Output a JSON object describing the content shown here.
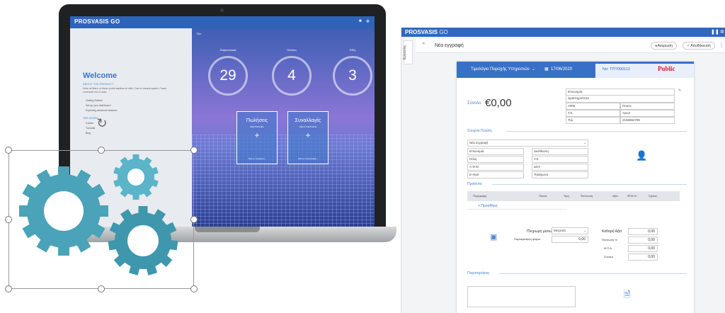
{
  "laptop_screen": {
    "logo": "PROSVASIS GO",
    "welcome": "Welcome",
    "about_title": "ABOUT THE PRODUCT",
    "about_text": "Dolor at libero ut donec porta dapibus mi nibh. Cras et mauris sapien. Fusce commodo est ut dolor.",
    "bullets": [
      "Getting Started",
      "Set up your dashboard",
      "Exploring advanced features"
    ],
    "see_more": "SEE MORE",
    "see_more_items": [
      "Guides",
      "Tutorials",
      "Blog"
    ],
    "date": "Title",
    "stats": [
      {
        "label": "Παραστατικά",
        "value": "29"
      },
      {
        "label": "Πελάτες",
        "value": "4"
      },
      {
        "label": "Είδη",
        "value": "3"
      }
    ],
    "cards": [
      {
        "title": "Πωλήσεις",
        "subtitle": "ΝΕΑ ΠΩΛΗΣΗ",
        "plus": "+",
        "link": "Νέα σε Πωλήσεις  ›"
      },
      {
        "title": "Συναλλαγές",
        "subtitle": "ΝΕΑ ΣΥΝΑΛΛΑΓΗ",
        "plus": "+",
        "link": "Νέα σε Συναλλαγές  ›"
      }
    ],
    "gear_color": "#4aa3b8"
  },
  "app": {
    "logo": "PROSVASIS",
    "logo_suffix": "GO",
    "side_tab": "Εργασίες",
    "breadcrumb": "Νέα εγγραφή",
    "back_label": "Ακύρωση",
    "save_label": "Αποθήκευση",
    "doc_type": "Τιμολόγιο Παροχής Υπηρεσιών",
    "doc_date": "17/06/2020",
    "doc_no": "Νο: ΤΠΥ000112",
    "brand": "Public",
    "total_label": "Σύνολο",
    "total_value": "€0,00",
    "party": {
      "name": "Επωνυμία",
      "activity": "Δραστηριότητα",
      "vat_label": "ΑΦΜ",
      "vat": "Ποσοτ.",
      "zip_label": "Τ.Κ.",
      "city": "Αγιο4",
      "phone_label": "Τηλ.",
      "phone": "2155552780"
    },
    "customer_section": "Στοιχεία Πελάτη",
    "customer_fields": {
      "select": "Νέα εγγραφή",
      "name": "Επωνυμία",
      "city": "Πόλη",
      "vat": "Α.Φ.Μ",
      "email": "E-mail",
      "address": "Διεύθυνση",
      "zip": "Τ.Κ.",
      "doy": "ΔΟΥ",
      "phone": "Τηλέφωνο"
    },
    "lines_section": "Προϊόντα",
    "columns": [
      "Περιγραφή",
      "Ποσότ.",
      "Τιμή",
      "Έκπτωση",
      "Αξία",
      "ΦΠΑ %",
      "Σχόλια"
    ],
    "add_line": "+ Προσθήκη",
    "payment_label": "Πληρωμή μέσω",
    "payment_value": "Μετρητά",
    "withholding_label": "Παρακράτηση φόρου",
    "withholding_value": "0,00",
    "totals": [
      {
        "label": "Καθαρή Αξία",
        "value": "0,00"
      },
      {
        "label": "Έκπτωση %",
        "value": "0,00"
      },
      {
        "label": "Φ.Π.Α.",
        "value": "0,00"
      },
      {
        "label": "Σύνολο",
        "value": "0,00"
      }
    ],
    "notes_section": "Παρατηρήσεις"
  }
}
